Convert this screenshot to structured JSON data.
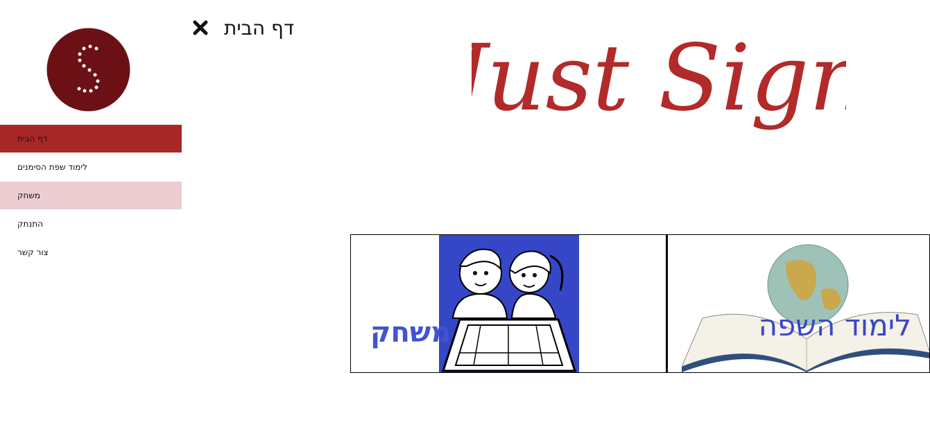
{
  "header": {
    "page_title": "דף הבית",
    "close_icon": "close-icon"
  },
  "brand": {
    "logo_text": "Just Sign",
    "logo_color": "#b22a2a",
    "emblem_letter": "S"
  },
  "sidebar": {
    "items": [
      {
        "label": "דף הבית",
        "state": "active"
      },
      {
        "label": "לימוד שפת הסימנים",
        "state": "normal"
      },
      {
        "label": "משחק",
        "state": "hover"
      },
      {
        "label": "התנתק",
        "state": "normal"
      },
      {
        "label": "צור קשר",
        "state": "normal"
      }
    ]
  },
  "tiles": {
    "game": {
      "label": "משחק"
    },
    "learn": {
      "label": "לימוד השפה"
    }
  },
  "colors": {
    "accent": "#a82828",
    "hover": "#ebcdd2",
    "tile_text": "#3a46c8"
  }
}
